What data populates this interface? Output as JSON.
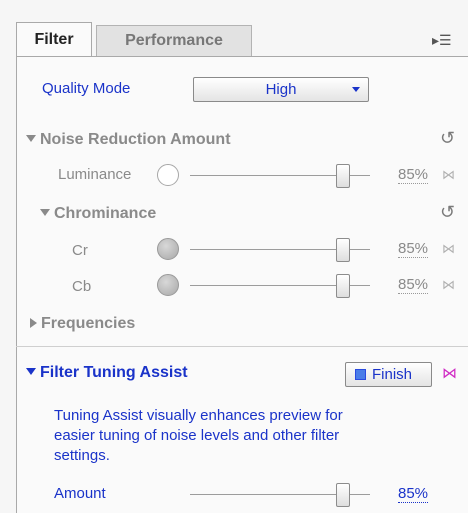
{
  "tabs": [
    {
      "label": "Filter",
      "active": true
    },
    {
      "label": "Performance",
      "active": false
    }
  ],
  "panel_menu_icon": "flyout-menu-icon",
  "quality": {
    "label": "Quality Mode",
    "value": "High"
  },
  "noise_reduction": {
    "title": "Noise Reduction Amount",
    "luminance": {
      "label": "Luminance",
      "value": "85%",
      "level": 0.85
    }
  },
  "chrominance": {
    "title": "Chrominance",
    "cr": {
      "label": "Cr",
      "value": "85%",
      "level": 0.85
    },
    "cb": {
      "label": "Cb",
      "value": "85%",
      "level": 0.85
    }
  },
  "frequencies": {
    "title": "Frequencies",
    "expanded": false
  },
  "tuning": {
    "title": "Filter Tuning Assist",
    "finish_label": "Finish",
    "description": "Tuning Assist visually enhances preview for easier tuning of noise levels and other filter settings.",
    "amount": {
      "label": "Amount",
      "value": "85%",
      "level": 0.85
    }
  },
  "colors": {
    "accent": "#1a33c9",
    "muted": "#8a8a8a",
    "link_active": "#d02ac4"
  },
  "icons": {
    "reset": "reset-icon",
    "link": "link-bowtie-icon",
    "collapse": "triangle-down-icon",
    "expand": "triangle-right-icon"
  }
}
